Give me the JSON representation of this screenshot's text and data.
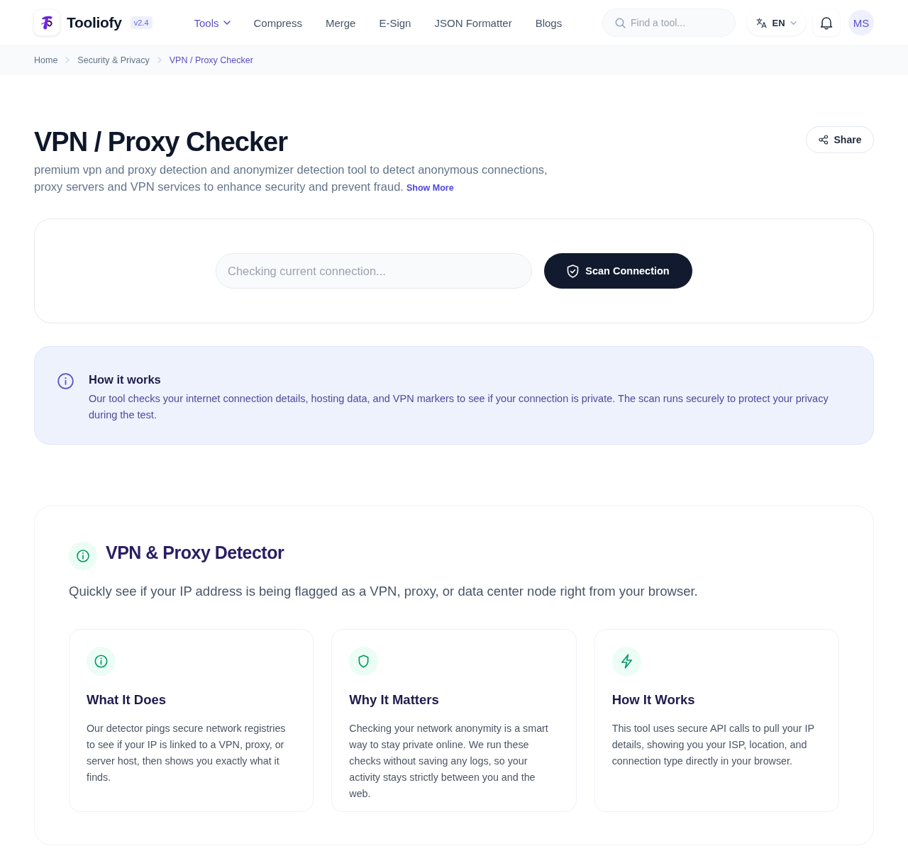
{
  "header": {
    "logo": {
      "name": "Tooliofy",
      "version": "v2.4"
    },
    "nav": [
      {
        "label": "Tools",
        "selected": true,
        "has_menu": true
      },
      {
        "label": "Compress",
        "selected": false,
        "has_menu": false
      },
      {
        "label": "Merge",
        "selected": false,
        "has_menu": false
      },
      {
        "label": "E-Sign",
        "selected": false,
        "has_menu": false
      },
      {
        "label": "JSON Formatter",
        "selected": false,
        "has_menu": false
      },
      {
        "label": "Blogs",
        "selected": false,
        "has_menu": false
      }
    ],
    "search": {
      "placeholder": "Find a tool..."
    },
    "language": {
      "code": "EN"
    },
    "avatar": {
      "initials": "MS"
    }
  },
  "breadcrumb": [
    {
      "label": "Home",
      "selected": false
    },
    {
      "label": "Security & Privacy",
      "selected": false
    },
    {
      "label": "VPN / Proxy Checker",
      "selected": true
    }
  ],
  "page": {
    "title": "VPN / Proxy Checker",
    "description": "premium vpn and proxy detection and anonymizer detection tool to detect anonymous connections, proxy servers and VPN services to enhance security and prevent fraud.",
    "show_more": "Show More",
    "share": "Share"
  },
  "scan": {
    "placeholder": "Checking current connection...",
    "button": "Scan Connection"
  },
  "notice": {
    "title": "How it works",
    "text": "Our tool checks your internet connection details, hosting data, and VPN markers to see if your connection is private. The scan runs securely to protect your privacy during the test."
  },
  "about": {
    "title": "VPN & Proxy Detector",
    "subtitle": "Quickly see if your IP address is being flagged as a VPN, proxy, or data center node right from your browser.",
    "cards": [
      {
        "kind": "info",
        "title": "What It Does",
        "text": "Our detector pings secure network registries to see if your IP is linked to a VPN, proxy, or server host, then shows you exactly what it finds."
      },
      {
        "kind": "shield",
        "title": "Why It Matters",
        "text": "Checking your network anonymity is a smart way to stay private online. We run these checks without saving any logs, so your activity stays strictly between you and the web."
      },
      {
        "kind": "bolt",
        "title": "How It Works",
        "text": "This tool uses secure API calls to pull your IP details, showing you your ISP, location, and connection type directly in your browser."
      }
    ]
  }
}
